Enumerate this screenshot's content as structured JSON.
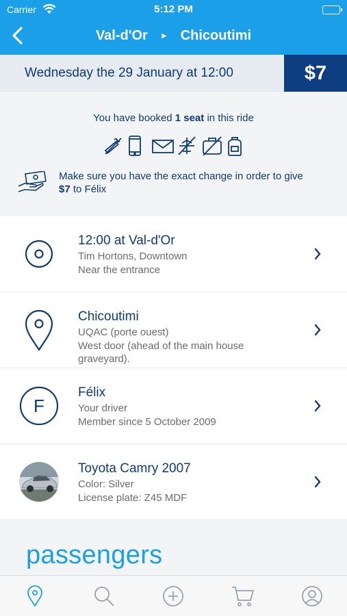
{
  "status_bar": {
    "carrier": "Carrier",
    "time": "5:12 PM"
  },
  "nav": {
    "from": "Val-d'Or",
    "to": "Chicoutimi",
    "separator": "►"
  },
  "trip": {
    "date": "Wednesday the 29 January at 12:00",
    "price": "$7"
  },
  "booking": {
    "seats_prefix": "You have booked ",
    "seats_bold": "1 seat",
    "seats_suffix": " in this ride",
    "feature_icons": [
      "no-smoking-icon",
      "phone-icon",
      "email-icon",
      "no-flights-icon",
      "no-luggage-icon",
      "backpack-icon"
    ],
    "payment_line1": "Make sure you have the exact change in order to give",
    "payment_amount": "$7",
    "payment_to": " to Félix"
  },
  "stops": [
    {
      "title": "12:00 at Val-d'Or",
      "line1": "Tim Hortons, Downtown",
      "line2": "Near the entrance"
    },
    {
      "title": "Chicoutimi",
      "line1": "UQAC (porte ouest)",
      "line2": "West door (ahead of the main house graveyard)."
    }
  ],
  "driver": {
    "initial": "F",
    "name": "Félix",
    "role": "Your driver",
    "member_since": "Member since 5 October 2009"
  },
  "car": {
    "model": "Toyota Camry 2007",
    "color": "Color: Silver",
    "plate": "License plate: Z45 MDF"
  },
  "passengers_heading": "passengers",
  "tabs": [
    "map-pin-icon",
    "search-icon",
    "add-icon",
    "cart-icon",
    "profile-icon"
  ],
  "colors": {
    "header": "#1a9fe8",
    "navy": "#0e3d82",
    "text": "#0f3a73"
  }
}
